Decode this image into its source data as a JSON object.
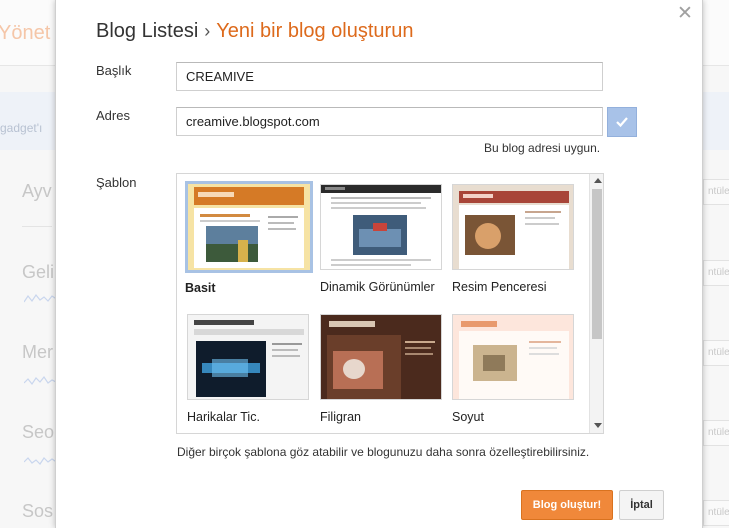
{
  "background": {
    "page_title": "Yönet",
    "gadget_text": "gadget'ı",
    "rows": [
      {
        "label": "Ayv"
      },
      {
        "label": "Geli"
      },
      {
        "label": "Mer"
      },
      {
        "label": "Seo"
      },
      {
        "label": "Sos"
      }
    ],
    "right_button_label": "ntüle"
  },
  "dialog": {
    "breadcrumb_parent": "Blog Listesi",
    "breadcrumb_separator": "›",
    "breadcrumb_current": "Yeni bir blog oluşturun",
    "close_icon": "close-icon",
    "title_field": {
      "label": "Başlık",
      "value": "CREAMIVE"
    },
    "address_field": {
      "label": "Adres",
      "value": "creamive.blogspot.com",
      "status": "Bu blog adresi uygun."
    },
    "template_label": "Şablon",
    "templates": [
      {
        "name": "Basit",
        "selected": true
      },
      {
        "name": "Dinamik Görünümler",
        "selected": false
      },
      {
        "name": "Resim Penceresi",
        "selected": false
      },
      {
        "name": "Harikalar Tic.",
        "selected": false
      },
      {
        "name": "Filigran",
        "selected": false
      },
      {
        "name": "Soyut",
        "selected": false
      }
    ],
    "hint": "Diğer birçok şablona göz atabilir ve blogunuzu daha sonra özelleştirebilirsiniz.",
    "create_button": "Blog oluştur!",
    "cancel_button": "İptal"
  },
  "colors": {
    "accent_orange": "#dd6a1c",
    "create_button": "#f0883a",
    "check_button": "#a8c2e8"
  }
}
